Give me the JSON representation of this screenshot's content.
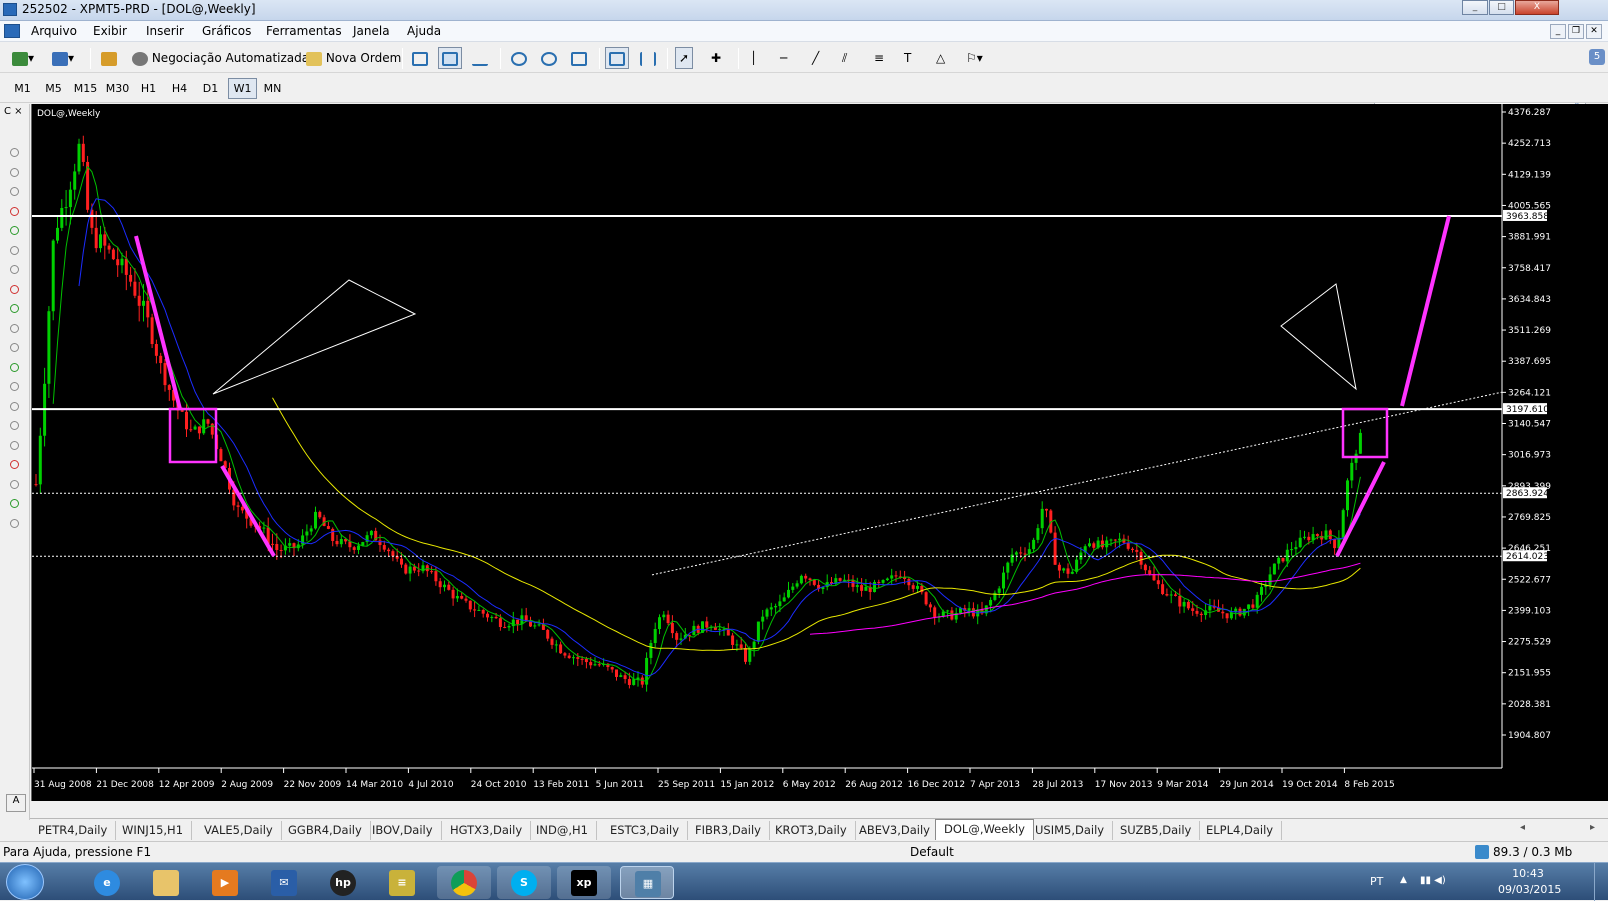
{
  "window": {
    "title": "252502 - XPMT5-PRD - [DOL@,Weekly]",
    "controls": [
      "_",
      "□",
      "X"
    ]
  },
  "menu": [
    "Arquivo",
    "Exibir",
    "Inserir",
    "Gráficos",
    "Ferramentas",
    "Janela",
    "Ajuda"
  ],
  "toolbar": {
    "auto_trading": "Negociação Automatizada",
    "new_order": "Nova Ordem"
  },
  "timeframes": [
    "M1",
    "M5",
    "M15",
    "M30",
    "H1",
    "H4",
    "D1",
    "W1",
    "MN"
  ],
  "active_timeframe": "W1",
  "chart": {
    "symbol_label": "DOL@,Weekly",
    "background": "#000000",
    "price_labels": [
      "4376.287",
      "4252.713",
      "4129.139",
      "4005.565",
      "3881.991",
      "3758.417",
      "3634.843",
      "3511.269",
      "3387.695",
      "3264.121",
      "3140.547",
      "3016.973",
      "2893.399",
      "2769.825",
      "2646.251",
      "2522.677",
      "2399.103",
      "2275.529",
      "2151.955",
      "2028.381",
      "1904.807"
    ],
    "hline_labels": [
      "3963.858",
      "3197.610",
      "2863.924",
      "2614.023"
    ],
    "date_labels": [
      "31 Aug 2008",
      "21 Dec 2008",
      "12 Apr 2009",
      "2 Aug 2009",
      "22 Nov 2009",
      "14 Mar 2010",
      "4 Jul 2010",
      "24 Oct 2010",
      "13 Feb 2011",
      "5 Jun 2011",
      "25 Sep 2011",
      "15 Jan 2012",
      "6 May 2012",
      "26 Aug 2012",
      "16 Dec 2012",
      "7 Apr 2013",
      "28 Jul 2013",
      "17 Nov 2013",
      "9 Mar 2014",
      "29 Jun 2014",
      "19 Oct 2014",
      "8 Feb 2015"
    ],
    "colors": {
      "bull": "#00d000",
      "bear": "#ff2020",
      "ma_fast": "#00c000",
      "ma_mid": "#1c2cff",
      "ma_slow": "#e8e800",
      "ma_long": "#ff00ff",
      "annotation": "#ff33ff",
      "lines": "#ffffff"
    }
  },
  "tabs": [
    "PETR4,Daily",
    "WINJ15,H1",
    "VALE5,Daily",
    "GGBR4,Daily",
    "IBOV,Daily",
    "HGTX3,Daily",
    "IND@,H1",
    "ESTC3,Daily",
    "FIBR3,Daily",
    "KROT3,Daily",
    "ABEV3,Daily",
    "DOL@,Weekly",
    "USIM5,Daily",
    "SUZB5,Daily",
    "ELPL4,Daily"
  ],
  "active_tab": "DOL@,Weekly",
  "status": {
    "help": "Para Ajuda, pressione F1",
    "profile": "Default",
    "connection": "89.3 / 0.3 Mb"
  },
  "taskbar": {
    "lang": "PT",
    "time": "10:43",
    "date": "09/03/2015",
    "apps": [
      "start-icon",
      "ie-icon",
      "explorer-icon",
      "media-icon",
      "outlook-icon",
      "hp-icon",
      "files-icon",
      "chrome-icon",
      "skype-icon",
      "xp-icon",
      "metatrader-icon"
    ]
  }
}
